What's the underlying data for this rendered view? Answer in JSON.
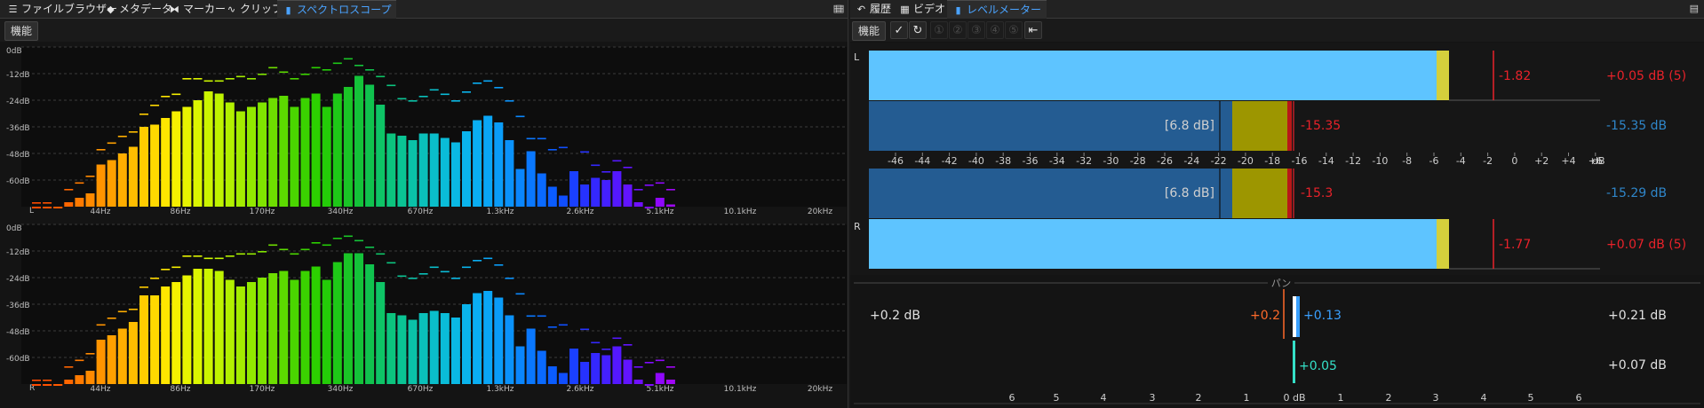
{
  "left": {
    "tabs": [
      {
        "label": "ファイルブラウザー",
        "icon": "menu-icon",
        "glyph": "☰",
        "x": 8
      },
      {
        "label": "メタデータ",
        "icon": "tag-icon",
        "glyph": "◆",
        "x": 118
      },
      {
        "label": "マーカー",
        "icon": "marker-icon",
        "glyph": "⧓",
        "x": 190
      },
      {
        "label": "クリップ",
        "icon": "clip-icon",
        "glyph": "∿",
        "x": 254
      },
      {
        "label": "スペクトロスコープ",
        "icon": "bar-chart-icon",
        "glyph": "▮",
        "x": 312,
        "active": true
      }
    ],
    "function_label": "機能",
    "pin_icon": "pin-icon"
  },
  "right": {
    "tabs": [
      {
        "label": "履歴",
        "icon": "undo-icon",
        "glyph": "↶",
        "x": 6
      },
      {
        "label": "ビデオ",
        "icon": "film-icon",
        "glyph": "▦",
        "x": 55
      },
      {
        "label": "レベルメーター",
        "icon": "bar-chart-icon",
        "glyph": "▮",
        "x": 109,
        "active": true
      }
    ],
    "function_label": "機能"
  },
  "chart_data": [
    {
      "type": "bar",
      "name": "spectroscope-left",
      "channel": "L",
      "y_ticks": [
        "0dB",
        "-12dB",
        "-24dB",
        "-36dB",
        "-48dB",
        "-60dB"
      ],
      "ylim": [
        -72,
        0
      ],
      "x_ticks": [
        "44Hz",
        "86Hz",
        "170Hz",
        "340Hz",
        "670Hz",
        "1.3kHz",
        "2.6kHz",
        "5.1kHz",
        "10.1kHz",
        "20kHz"
      ],
      "values": [
        -72,
        -72,
        -72,
        -70,
        -68,
        -66,
        -53,
        -51,
        -48,
        -45,
        -36,
        -35,
        -32,
        -29,
        -27,
        -24,
        -20,
        -21,
        -25,
        -29,
        -27,
        -25,
        -23,
        -22,
        -27,
        -23,
        -21,
        -27,
        -21,
        -18,
        -13,
        -17,
        -26,
        -39,
        -40,
        -42,
        -39,
        -39,
        -41,
        -43,
        -38,
        -33,
        -31,
        -34,
        -42,
        -55,
        -47,
        -57,
        -63,
        -67,
        -56,
        -62,
        -59,
        -60,
        -56,
        -62,
        -70,
        -72,
        -68,
        -71
      ],
      "peaks": [
        -70,
        -70,
        -72,
        -64,
        -61,
        -58,
        -46,
        -43,
        -40,
        -38,
        -30,
        -26,
        -22,
        -21,
        -14,
        -14,
        -15,
        -15,
        -14,
        -13,
        -14,
        -12,
        -9,
        -11,
        -14,
        -12,
        -9,
        -10,
        -7,
        -5,
        -8,
        -10,
        -13,
        -17,
        -23,
        -24,
        -22,
        -19,
        -21,
        -24,
        -20,
        -16,
        -15,
        -18,
        -24,
        -31,
        -41,
        -41,
        -46,
        -45,
        -57,
        -47,
        -53,
        -56,
        -51,
        -54,
        -64,
        -62,
        -61,
        -64
      ],
      "colors": [
        "#ff4a00",
        "#ff5200",
        "#ff5a00",
        "#ff6600",
        "#ff7a00",
        "#ff8a00",
        "#ff9400",
        "#ffa000",
        "#ffae00",
        "#ffbe00",
        "#ffcc00",
        "#ffd900",
        "#ffe600",
        "#f6f000",
        "#e8f400",
        "#dcf600",
        "#ccf500",
        "#bff400",
        "#b2f000",
        "#a4ec00",
        "#92e800",
        "#80e400",
        "#6ede00",
        "#5cda00",
        "#4ad600",
        "#3ad200",
        "#2cd000",
        "#24cc08",
        "#1ec817",
        "#1ac426",
        "#14c239",
        "#10c24e",
        "#0ec466",
        "#0cc47e",
        "#0ac494",
        "#0ac2a8",
        "#0ac0ba",
        "#0abeca",
        "#0abcd8",
        "#0ab8e4",
        "#0ab4ec",
        "#0aaef2",
        "#0aa6f6",
        "#0a9cf8",
        "#0a92fa",
        "#0a86fc",
        "#0a78fe",
        "#0a6aff",
        "#0a5cff",
        "#104eff",
        "#1a40ff",
        "#2632ff",
        "#3428ff",
        "#4420ff",
        "#5418ff",
        "#6214ff",
        "#7010ff",
        "#800cff",
        "#9008fc",
        "#a006f6"
      ]
    },
    {
      "type": "bar",
      "name": "spectroscope-right",
      "channel": "R",
      "y_ticks": [
        "0dB",
        "-12dB",
        "-24dB",
        "-36dB",
        "-48dB",
        "-60dB"
      ],
      "ylim": [
        -72,
        0
      ],
      "x_ticks": [
        "44Hz",
        "86Hz",
        "170Hz",
        "340Hz",
        "670Hz",
        "1.3kHz",
        "2.6kHz",
        "5.1kHz",
        "10.1kHz",
        "20kHz"
      ],
      "values": [
        -72,
        -72,
        -72,
        -70,
        -68,
        -66,
        -52,
        -50,
        -47,
        -44,
        -32,
        -32,
        -28,
        -26,
        -23,
        -20,
        -20,
        -21,
        -25,
        -28,
        -26,
        -24,
        -22,
        -21,
        -25,
        -21,
        -19,
        -25,
        -17,
        -13,
        -13,
        -18,
        -26,
        -40,
        -41,
        -43,
        -40,
        -39,
        -40,
        -42,
        -36,
        -31,
        -30,
        -33,
        -41,
        -55,
        -47,
        -57,
        -64,
        -67,
        -56,
        -62,
        -58,
        -59,
        -55,
        -61,
        -70,
        -72,
        -67,
        -70
      ],
      "peaks": [
        -70,
        -70,
        -72,
        -64,
        -61,
        -58,
        -45,
        -42,
        -39,
        -38,
        -28,
        -24,
        -20,
        -19,
        -14,
        -14,
        -15,
        -15,
        -14,
        -13,
        -13,
        -12,
        -9,
        -11,
        -13,
        -11,
        -8,
        -9,
        -6,
        -5,
        -7,
        -10,
        -13,
        -17,
        -23,
        -24,
        -22,
        -19,
        -21,
        -24,
        -19,
        -16,
        -15,
        -18,
        -24,
        -31,
        -41,
        -41,
        -46,
        -45,
        -57,
        -47,
        -53,
        -56,
        -51,
        -54,
        -64,
        -62,
        -61,
        -64
      ]
    },
    {
      "type": "bar",
      "name": "level-meter",
      "orientation": "horizontal",
      "x_ticks": [
        "-46",
        "-44",
        "-42",
        "-40",
        "-38",
        "-36",
        "-34",
        "-32",
        "-30",
        "-28",
        "-26",
        "-24",
        "-22",
        "-20",
        "-18",
        "-16",
        "-14",
        "-12",
        "-10",
        "-8",
        "-6",
        "-4",
        "-2",
        "0",
        "+2",
        "+4",
        "+6"
      ],
      "x_unit": "dB",
      "xlim": [
        -48,
        6
      ],
      "channels": [
        {
          "label": "L",
          "peak": -6,
          "hold": -1.82,
          "hold_label": "-1.82",
          "peak_text": "+0.05 dB (5)",
          "rms": -20,
          "rms_mark": -22,
          "loud_end": -16,
          "rms_text": "-15.35",
          "rms_right": "-15.35 dB",
          "range_text": "[6.8 dB]"
        },
        {
          "label": "R",
          "peak": -6,
          "hold": -1.77,
          "hold_label": "-1.77",
          "peak_text": "+0.07 dB (5)",
          "rms": -20,
          "rms_mark": -22,
          "loud_end": -16,
          "rms_text": "-15.3",
          "rms_right": "-15.29 dB",
          "range_text": "[6.8 dB]"
        }
      ],
      "colors": {
        "peak_bar": "#5ec4ff",
        "peak_cap": "#d4cf3c",
        "rms_bar": "#245c92",
        "loud_bar": "#9d9600",
        "red": "#e8222a",
        "blue": "#2f86c9"
      }
    },
    {
      "type": "bar",
      "name": "pan-meter",
      "title": "パン",
      "x_ticks": [
        "6",
        "5",
        "4",
        "3",
        "2",
        "1",
        "0 dB",
        "1",
        "2",
        "3",
        "4",
        "5",
        "6"
      ],
      "left_value": "+0.2 dB",
      "right_value": "+0.21 dB",
      "lower_right_value": "+0.07 dB",
      "pan_left": "+0.2",
      "pan_right": "+0.13",
      "pan_center": "+0.05",
      "colors": {
        "left": "#ff6a2a",
        "right": "#3aa0ff",
        "center": "#35e0c8"
      }
    }
  ]
}
